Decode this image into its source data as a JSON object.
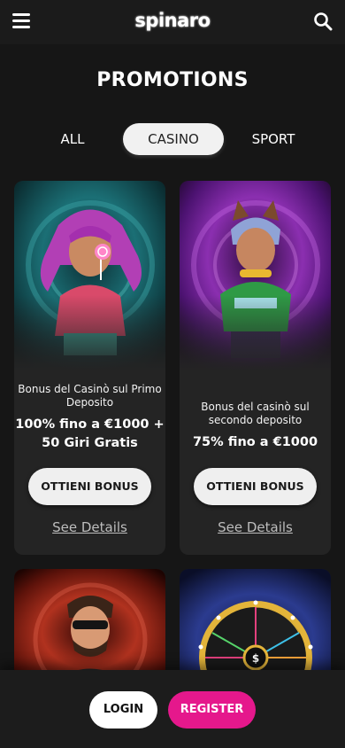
{
  "header": {
    "logo_text": "spinaro",
    "menu_icon": "hamburger-menu-icon",
    "search_icon": "search-icon"
  },
  "page": {
    "title": "PROMOTIONS"
  },
  "tabs": [
    {
      "label": "ALL",
      "active": false
    },
    {
      "label": "CASINO",
      "active": true
    },
    {
      "label": "SPORT",
      "active": false
    }
  ],
  "promotions": [
    {
      "subtitle": "Bonus del Casinò sul Primo Deposito",
      "offer": "100% fino a €1000 + 50 Giri Gratis",
      "button": "OTTIENI BONUS",
      "details": "See Details",
      "art": "girl-with-lollipop-illustration",
      "accent": "#1d6f74"
    },
    {
      "subtitle": "Bonus del casinò sul secondo deposito",
      "offer": "75% fino a €1000",
      "button": "OTTIENI BONUS",
      "details": "See Details",
      "art": "character-with-cat-ears-illustration",
      "accent": "#7b1fa2"
    },
    {
      "art": "man-with-sunglasses-illustration",
      "accent": "#a3251a"
    },
    {
      "art": "prize-wheel-illustration",
      "accent": "#1f2a6b"
    }
  ],
  "footer": {
    "login": "LOGIN",
    "register": "REGISTER",
    "register_color": "#e5188c"
  }
}
